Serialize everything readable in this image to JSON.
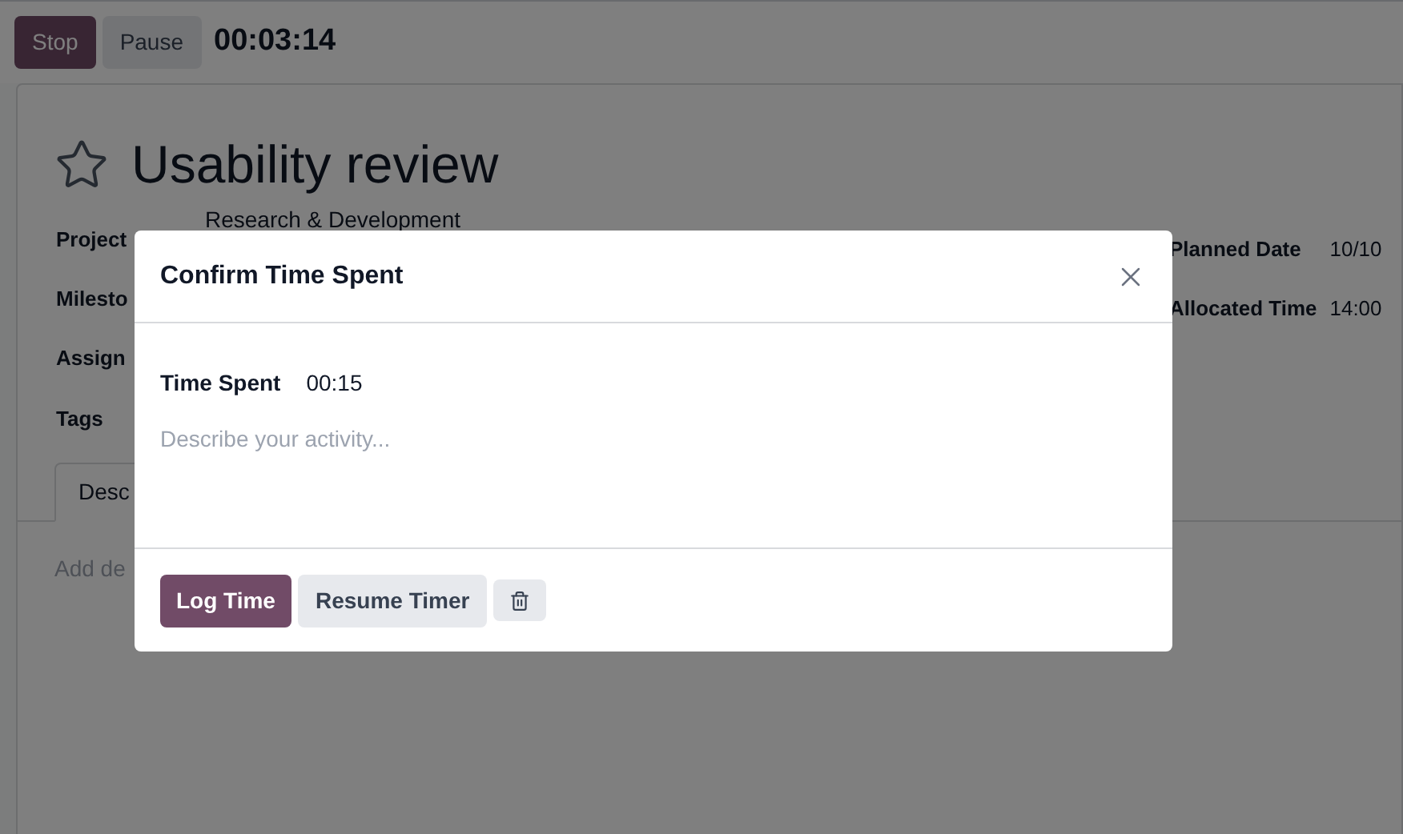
{
  "timer": {
    "buttons": [
      {
        "label": "Stop",
        "kind": "primary"
      },
      {
        "label": "Pause",
        "kind": "secondary"
      }
    ],
    "elapsed": "00:03:14"
  },
  "task": {
    "title": "Usability review",
    "starred": false,
    "fields_left": [
      {
        "label": "Project",
        "value": "Research & Development"
      },
      {
        "label": "Milesto"
      },
      {
        "label": "Assign"
      },
      {
        "label": "Tags"
      }
    ],
    "fields_right": [
      {
        "label": "Planned Date",
        "value": "10/10"
      },
      {
        "label": "Allocated Time",
        "value": "14:00"
      }
    ],
    "tabs": [
      {
        "label": "Desc",
        "selected": true
      }
    ],
    "description_placeholder": "Add de"
  },
  "dialog": {
    "title": "Confirm Time Spent",
    "time_label": "Time Spent",
    "time_value": "00:15",
    "description_placeholder": "Describe your activity...",
    "buttons": [
      {
        "label": "Log Time",
        "kind": "primary"
      },
      {
        "label": "Resume Timer",
        "kind": "secondary"
      },
      {
        "kind": "delete"
      }
    ]
  }
}
